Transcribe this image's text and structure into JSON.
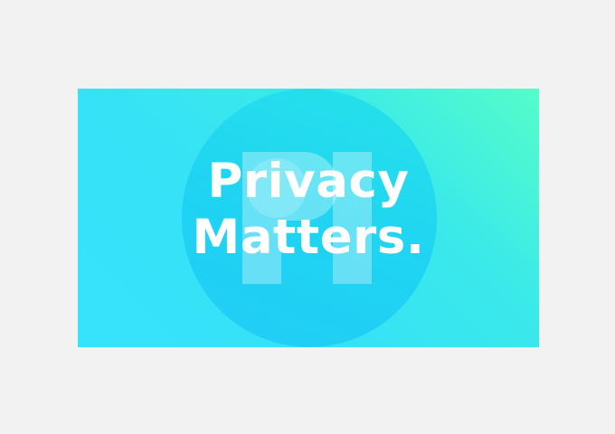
{
  "banner": {
    "headline_line1": "Privacy",
    "headline_line2": "Matters.",
    "logo_icon": "pi-logo-icon",
    "colors": {
      "background_page": "#f2f2f2",
      "gradient_start": "#55fdc9",
      "gradient_end": "#36e3fc",
      "circle": "#1fd3f2",
      "text": "#ffffff"
    }
  }
}
